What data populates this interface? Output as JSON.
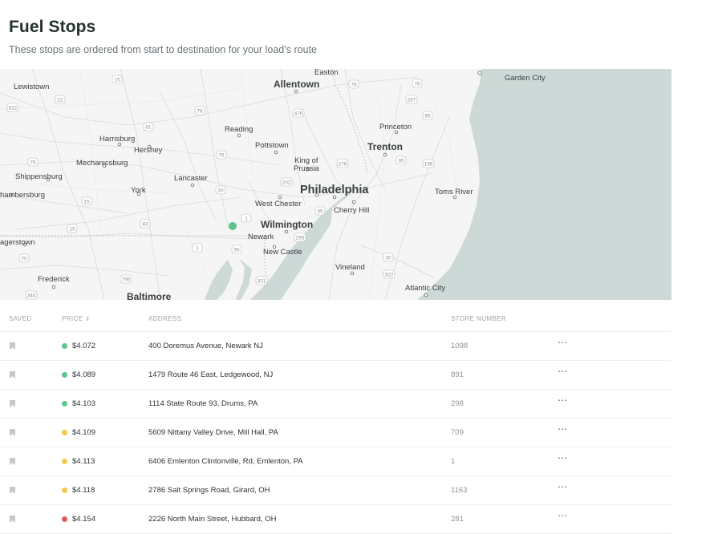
{
  "header": {
    "title": "Fuel Stops",
    "subtitle": "These stops are ordered from start to destination for your load’s route"
  },
  "map": {
    "marker_color": "#5cc48d",
    "labels": {
      "easton": "Easton",
      "lewistown": "Lewistown",
      "allentown": "Allentown",
      "garden_city": "Garden City",
      "reading": "Reading",
      "princeton": "Princeton",
      "harrisburg": "Harrisburg",
      "hershey": "Hershey",
      "pottstown": "Pottstown",
      "trenton": "Trenton",
      "mechanicsburg": "Mechanicsburg",
      "king_of_prussia_1": "King of",
      "king_of_prussia_2": "Prussia",
      "shippensburg": "Shippensburg",
      "lancaster": "Lancaster",
      "york": "York",
      "philadelphia": "Philadelphia",
      "toms_river": "Toms River",
      "chambersburg": "hambersburg",
      "west_chester": "West Chester",
      "cherry_hill": "Cherry Hill",
      "wilmington": "Wilmington",
      "hagerstown": "agerstown",
      "newark": "Newark",
      "new_castle": "New Castle",
      "vineland": "Vineland",
      "frederick": "Frederick",
      "atlantic_city": "Atlantic City",
      "baltimore": "Baltimore"
    },
    "shields": [
      "15",
      "22",
      "522",
      "78",
      "476",
      "78",
      "287",
      "81",
      "95",
      "76",
      "276",
      "295",
      "30",
      "202",
      "15",
      "83",
      "1",
      "15",
      "295",
      "70",
      "95",
      "30",
      "322",
      "70",
      "340",
      "795",
      "301"
    ]
  },
  "table": {
    "headers": {
      "saved": "SAVED",
      "price": "PRICE",
      "address": "ADDRESS",
      "store_number": "STORE NUMBER"
    },
    "price_sort_icon": "sort-icon",
    "more_glyph": "⋯",
    "status_colors": {
      "green": "#5cc48d",
      "yellow": "#f2c94c",
      "red": "#e25858"
    },
    "rows": [
      {
        "price": "$4.072",
        "status": "green",
        "address": "400 Doremus Avenue, Newark NJ",
        "store_number": "1098"
      },
      {
        "price": "$4.089",
        "status": "green",
        "address": "1479 Route 46 East, Ledgewood, NJ",
        "store_number": "891"
      },
      {
        "price": "$4.103",
        "status": "green",
        "address": "1114 State Route 93, Drums, PA",
        "store_number": "298"
      },
      {
        "price": "$4.109",
        "status": "yellow",
        "address": "5609 Nittany Valley Drive, Mill Hall, PA",
        "store_number": "709"
      },
      {
        "price": "$4.113",
        "status": "yellow",
        "address": "6406 Emlenton Clintonville, Rd, Emlenton, PA",
        "store_number": "1"
      },
      {
        "price": "$4.118",
        "status": "yellow",
        "address": "2786 Salt Springs Road, Girard, OH",
        "store_number": "1163"
      },
      {
        "price": "$4.154",
        "status": "red",
        "address": "2226 North Main Street, Hubbard, OH",
        "store_number": "281"
      }
    ]
  }
}
